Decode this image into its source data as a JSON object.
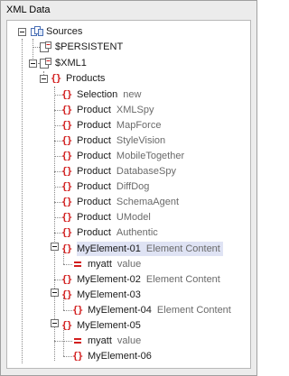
{
  "panel": {
    "title": "XML Data"
  },
  "tree": {
    "sources": {
      "label": "Sources"
    },
    "persistent": {
      "label": "$PERSISTENT"
    },
    "xml1": {
      "label": "$XML1"
    },
    "products": {
      "label": "Products"
    },
    "selection": {
      "name": "Selection",
      "value": "new"
    },
    "products_list": [
      {
        "name": "Product",
        "value": "XMLSpy"
      },
      {
        "name": "Product",
        "value": "MapForce"
      },
      {
        "name": "Product",
        "value": "StyleVision"
      },
      {
        "name": "Product",
        "value": "MobileTogether"
      },
      {
        "name": "Product",
        "value": "DatabaseSpy"
      },
      {
        "name": "Product",
        "value": "DiffDog"
      },
      {
        "name": "Product",
        "value": "SchemaAgent"
      },
      {
        "name": "Product",
        "value": "UModel"
      },
      {
        "name": "Product",
        "value": "Authentic"
      }
    ],
    "el01": {
      "name": "MyElement-01",
      "value": "Element Content"
    },
    "el01_attr": {
      "name": "myatt",
      "value": "value"
    },
    "el02": {
      "name": "MyElement-02",
      "value": "Element Content"
    },
    "el03": {
      "name": "MyElement-03"
    },
    "el04": {
      "name": "MyElement-04",
      "value": "Element Content"
    },
    "el05": {
      "name": "MyElement-05"
    },
    "el05_attr": {
      "name": "myatt",
      "value": "value"
    },
    "el06": {
      "name": "MyElement-06"
    }
  },
  "icons": {
    "sources": "sources-icon",
    "doc": "xml-document-icon",
    "element": "element-icon",
    "attribute": "attribute-icon"
  },
  "colors": {
    "element_brace": "#d21e1e",
    "value_text": "#6a6a6a",
    "selection_bg": "#dfe3f4"
  }
}
